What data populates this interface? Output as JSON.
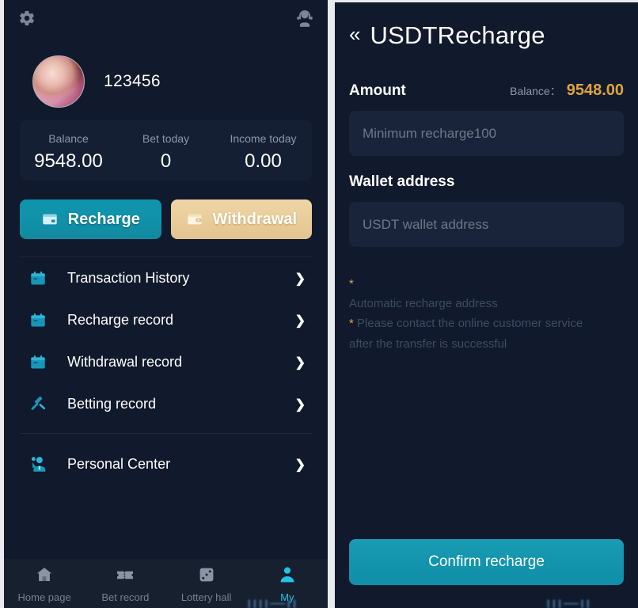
{
  "left_panel": {
    "topbar": {
      "settings_icon": "gear-icon",
      "service_icon": "customer-service-icon"
    },
    "profile": {
      "avatar": "user-avatar",
      "username": "123456"
    },
    "stats": [
      {
        "label": "Balance",
        "value": "9548.00"
      },
      {
        "label": "Bet today",
        "value": "0"
      },
      {
        "label": "Income today",
        "value": "0.00"
      }
    ],
    "actions": [
      {
        "id": "recharge",
        "label": "Recharge",
        "icon": "card-icon",
        "color": "#1193ac"
      },
      {
        "id": "withdrawal",
        "label": "Withdrawal",
        "icon": "wallet-icon",
        "color": "#e9cd9b"
      }
    ],
    "menu": [
      {
        "label": "Transaction History",
        "icon": "calendar-icon",
        "arrow": "❯"
      },
      {
        "label": "Recharge record",
        "icon": "calendar-icon",
        "arrow": "❯"
      },
      {
        "label": "Withdrawal record",
        "icon": "calendar-icon",
        "arrow": "❯"
      },
      {
        "label": "Betting record",
        "icon": "gavel-icon",
        "arrow": "❯"
      },
      {
        "label": "Personal Center",
        "icon": "user-profile-icon",
        "arrow": "❯"
      }
    ],
    "bottom_nav": [
      {
        "label": "Home page",
        "icon": "home-icon",
        "active": false
      },
      {
        "label": "Bet record",
        "icon": "ticket-icon",
        "active": false
      },
      {
        "label": "Lottery hall",
        "icon": "dice-icon",
        "active": false
      },
      {
        "label": "My",
        "icon": "person-icon",
        "active": true
      }
    ]
  },
  "right_panel": {
    "back_icon": "back-chevron-icon",
    "title": "USDTRecharge",
    "amount_label": "Amount",
    "balance_key": "Balance：",
    "balance_value": "9548.00",
    "amount_placeholder": "Minimum recharge100",
    "amount_value": "",
    "wallet_label": "Wallet address",
    "wallet_placeholder": "USDT wallet address",
    "wallet_value": "",
    "notes": {
      "star": "*",
      "line1": "Automatic recharge address",
      "line2_star": "*",
      "line2": " Please contact the online customer service",
      "line3": "after the transfer is successful"
    },
    "confirm_label": "Confirm recharge"
  },
  "artifacts": {
    "text_a": "ıııı—ıı",
    "text_b": "ııı—ıı"
  },
  "colors": {
    "panel_bg": "#101a2c",
    "card_bg": "#141f33",
    "accent_teal": "#1193ac",
    "accent_gold": "#e9cd9b",
    "balance_gold": "#e0a340",
    "nav_active": "#21c3e8",
    "divider": "#e9ebee"
  }
}
